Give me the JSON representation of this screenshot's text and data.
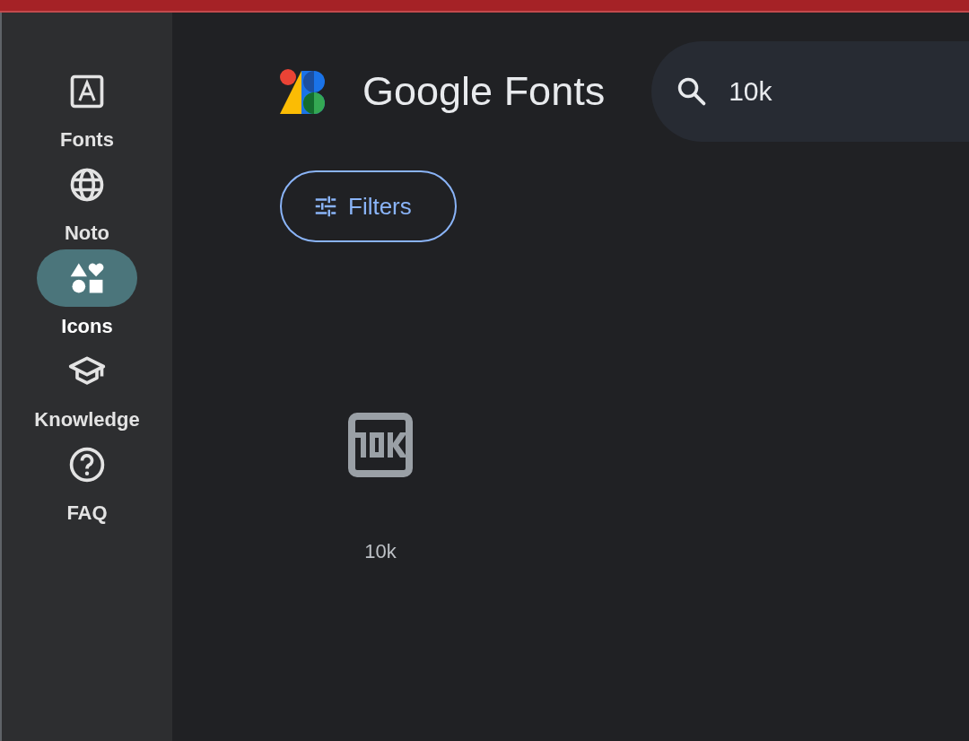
{
  "nav": [
    {
      "label": "Fonts",
      "kind": "font",
      "selected": false
    },
    {
      "label": "Noto",
      "kind": "globe",
      "selected": false
    },
    {
      "label": "Icons",
      "kind": "shapes",
      "selected": true
    },
    {
      "label": "Knowledge",
      "kind": "school",
      "selected": false
    },
    {
      "label": "FAQ",
      "kind": "help",
      "selected": false
    }
  ],
  "brand": {
    "name": "Google",
    "product": "Fonts"
  },
  "search": {
    "value": "10k"
  },
  "filters_button": "Filters",
  "results": [
    {
      "label": "10k",
      "kind": "tenk"
    }
  ]
}
